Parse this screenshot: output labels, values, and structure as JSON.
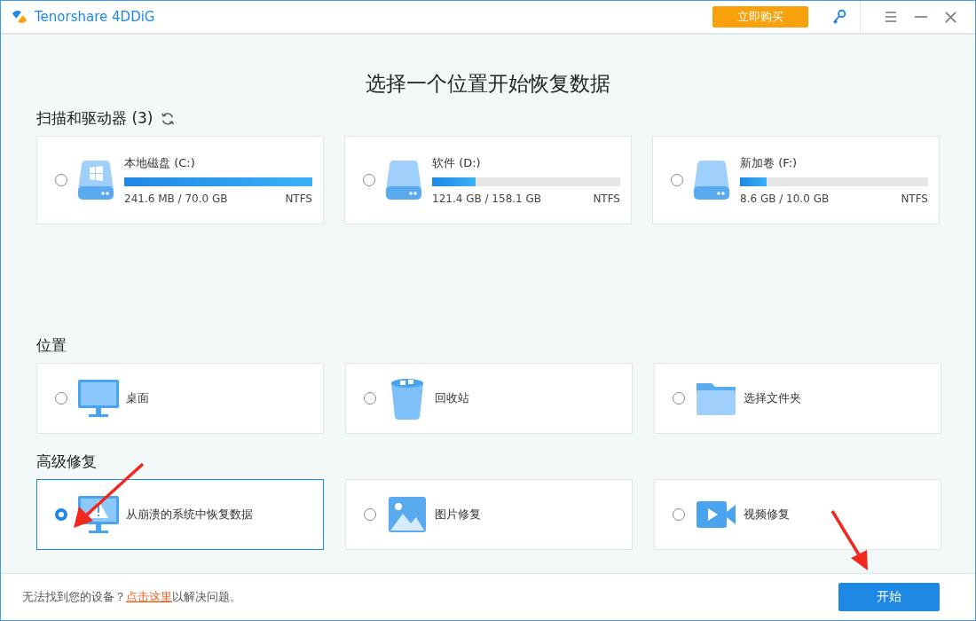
{
  "window": {
    "app_name": "Tenorshare 4DDiG",
    "buy_button": "立即购买"
  },
  "heading": "选择一个位置开始恢复数据",
  "drives_section": {
    "title": "扫描和驱动器 (3)",
    "drives": [
      {
        "name": "本地磁盘 (C:)",
        "kind": "system",
        "level": 1.0,
        "usage": "241.6 MB / 70.0 GB",
        "filesystem": "NTFS",
        "selected": false
      },
      {
        "name": "软件 (D:)",
        "kind": "data",
        "level": 0.23,
        "usage": "121.4 GB / 158.1 GB",
        "filesystem": "NTFS",
        "selected": false
      },
      {
        "name": "新加卷 (F:)",
        "kind": "data",
        "level": 0.14,
        "usage": "8.6 GB / 10.0 GB",
        "filesystem": "NTFS",
        "selected": false
      }
    ]
  },
  "locations_section": {
    "title": "位置",
    "items": [
      {
        "label": "桌面",
        "kind": "desktop",
        "selected": false
      },
      {
        "label": "回收站",
        "kind": "recycle",
        "selected": false
      },
      {
        "label": "选择文件夹",
        "kind": "folder",
        "selected": false
      }
    ]
  },
  "advanced_section": {
    "title": "高级修复",
    "items": [
      {
        "label": "从崩溃的系统中恢复数据",
        "kind": "crash",
        "selected": true
      },
      {
        "label": "图片修复",
        "kind": "photo",
        "selected": false
      },
      {
        "label": "视频修复",
        "kind": "video",
        "selected": false
      }
    ]
  },
  "footer": {
    "text_before": "无法找到您的设备？",
    "link": "点击这里",
    "text_after": "以解决问题。",
    "start_button": "开始"
  }
}
